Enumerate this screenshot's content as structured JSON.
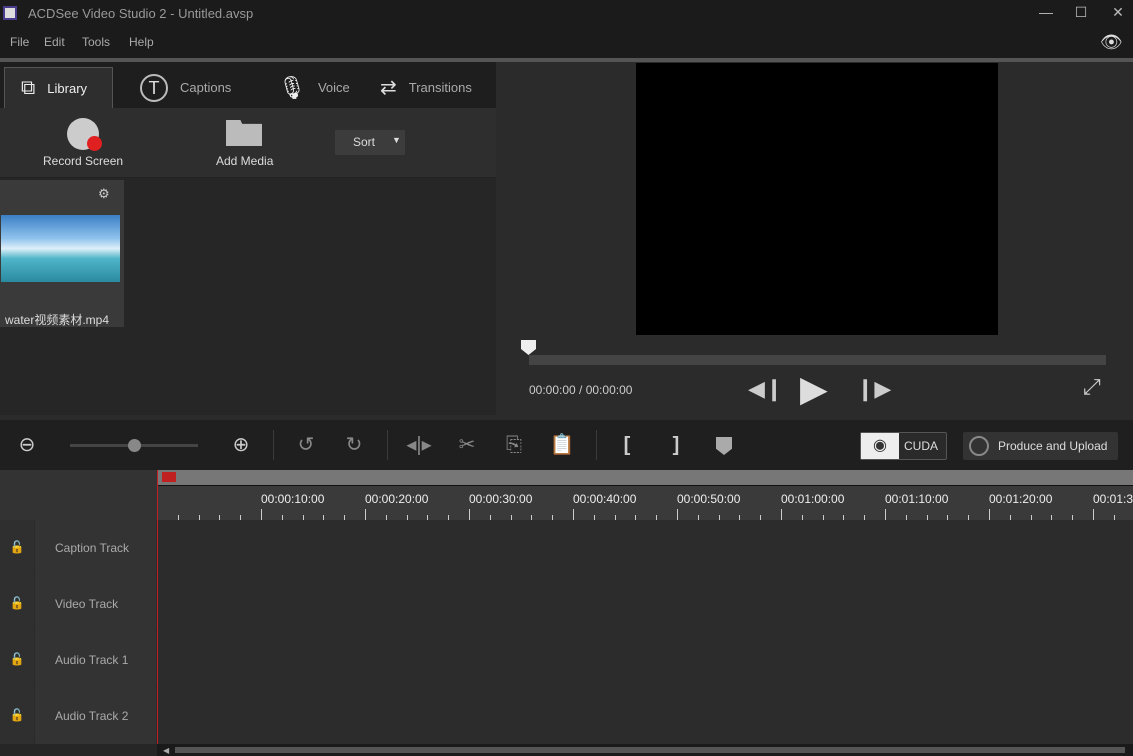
{
  "window": {
    "title": "ACDSee Video Studio 2 - Untitled.avsp"
  },
  "menu": [
    "File",
    "Edit",
    "Tools",
    "Help"
  ],
  "tabs": [
    {
      "label": "Library",
      "icon": "library-icon",
      "active": true
    },
    {
      "label": "Captions",
      "icon": "captions-icon"
    },
    {
      "label": "Voice",
      "icon": "microphone-icon"
    },
    {
      "label": "Transitions",
      "icon": "transitions-icon"
    }
  ],
  "library": {
    "record_label": "Record Screen",
    "add_media_label": "Add Media",
    "sort_label": "Sort",
    "items": [
      {
        "name": "water视频素材.mp4"
      }
    ]
  },
  "preview": {
    "time": "00:00:00 / 00:00:00",
    "progress": 0
  },
  "toolbar": {
    "cuda_label": "CUDA",
    "produce_label": "Produce and Upload",
    "zoom_level": 0.45
  },
  "ruler": [
    "00:00:10:00",
    "00:00:20:00",
    "00:00:30:00",
    "00:00:40:00",
    "00:00:50:00",
    "00:01:00:00",
    "00:01:10:00",
    "00:01:20:00",
    "00:01:3"
  ],
  "tracks": [
    "Caption Track",
    "Video Track",
    "Audio Track 1",
    "Audio Track 2"
  ],
  "colors": {
    "accent": "#c02020",
    "record": "#e02020"
  }
}
